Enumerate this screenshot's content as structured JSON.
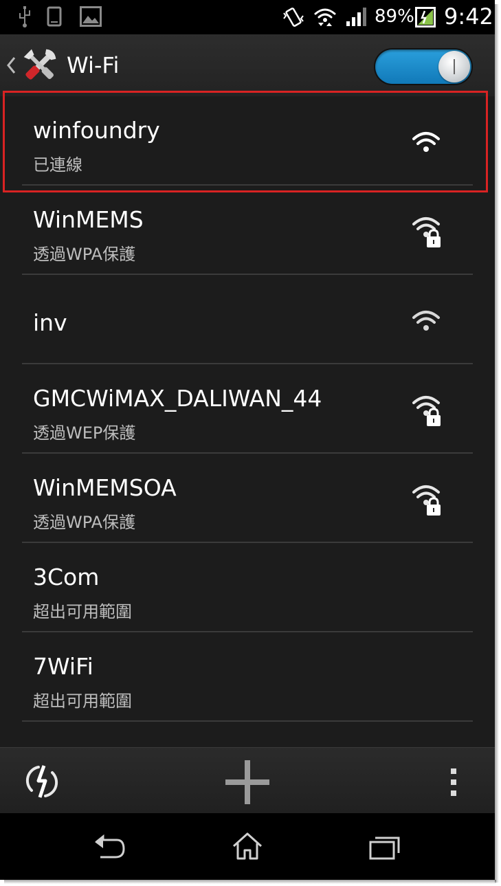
{
  "status_bar": {
    "battery_percent": "89%",
    "time": "9:42",
    "icons": [
      "usb-icon",
      "phone-icon",
      "image-icon",
      "vibrate-icon",
      "wifi-transfer-icon",
      "cell-signal-icon",
      "battery-charging-icon"
    ]
  },
  "action_bar": {
    "title": "Wi-Fi",
    "toggle_on": true
  },
  "networks": [
    {
      "ssid": "winfoundry",
      "status": "已連線",
      "secured": false,
      "selected": true
    },
    {
      "ssid": "WinMEMS",
      "status": "透過WPA保護",
      "secured": true,
      "selected": false
    },
    {
      "ssid": "inv",
      "status": "",
      "secured": false,
      "selected": false
    },
    {
      "ssid": "GMCWiMAX_DALIWAN_44",
      "status": "透過WEP保護",
      "secured": true,
      "selected": false
    },
    {
      "ssid": "WinMEMSOA",
      "status": "透過WPA保護",
      "secured": true,
      "selected": false
    },
    {
      "ssid": "3Com",
      "status": "超出可用範圍",
      "secured": false,
      "selected": false
    },
    {
      "ssid": "7WiFi",
      "status": "超出可用範圍",
      "secured": false,
      "selected": false
    }
  ],
  "bottom_bar": {
    "icons": [
      "wps-icon",
      "add-network-icon",
      "overflow-menu-icon"
    ]
  },
  "nav_bar": {
    "icons": [
      "back-icon",
      "home-icon",
      "recent-apps-icon"
    ]
  },
  "colors": {
    "accent": "#1b8ccd",
    "highlight": "#d92323",
    "background": "#1c1c1c"
  }
}
